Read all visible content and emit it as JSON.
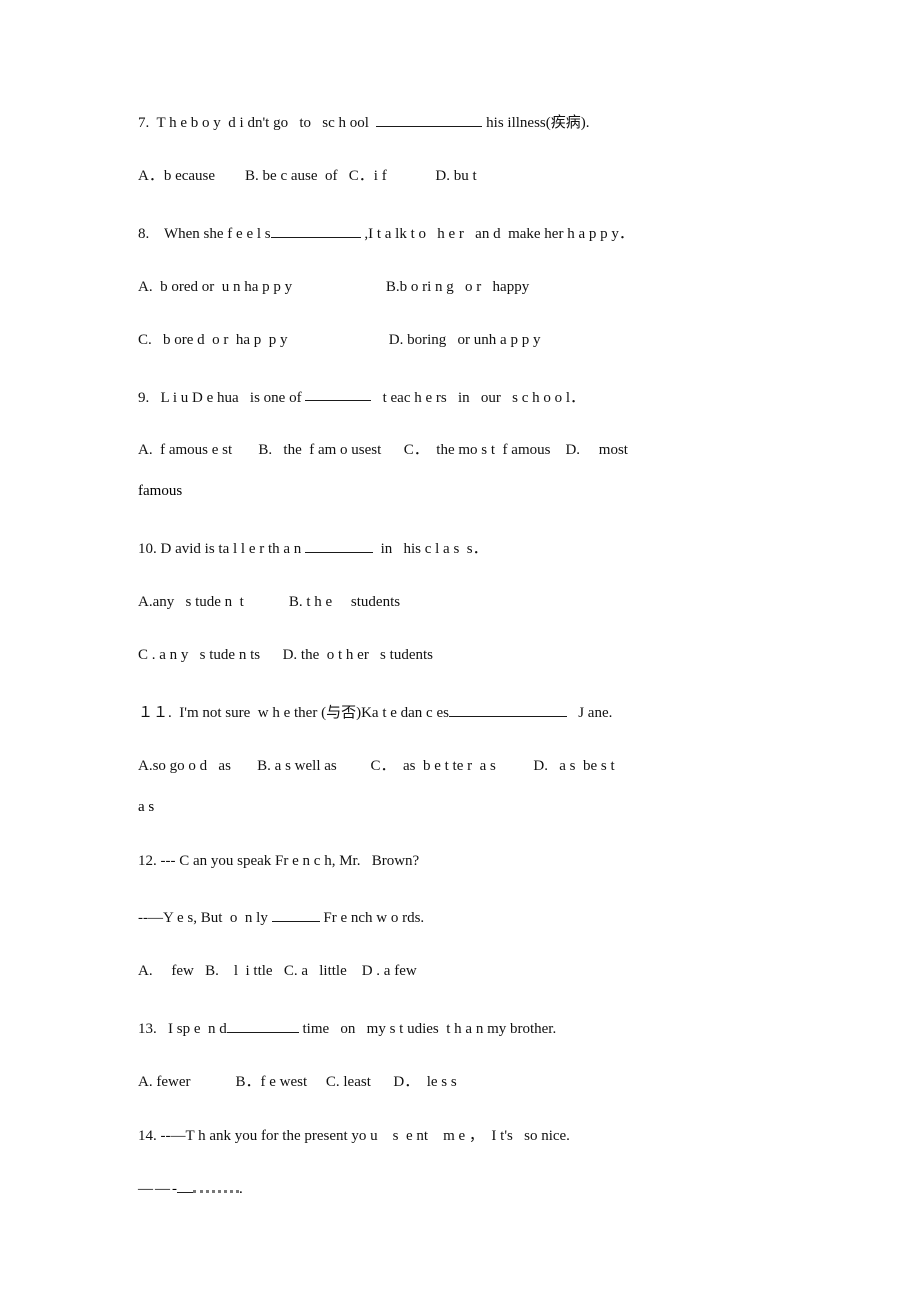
{
  "document": {
    "type": "english-grammar-worksheet",
    "question_range": "7-14",
    "background_color": "#ffffff",
    "text_color": "#111111"
  },
  "questions": [
    {
      "number": "7.",
      "stem_before": "7.  T h e b o y  d i dn't go   to   sc h ool  ",
      "stem_after": " his illness(疾病).",
      "options_line": "A．b ecause        B. be c ause  of   C．i f             D. bu t",
      "wrap": null
    },
    {
      "number": "8.",
      "stem_before": "8.    When she f e e l s",
      "stem_after": " ,I t a lk t o   h e r   an d  make her h a p p y．",
      "options_line": "A.  b ored or  u n ha p p y                         B.b o ri n g   o r   happy",
      "options_line2": "C.   b ore d  o r  ha p  p y                           D. boring   or unh a p p y",
      "wrap": null
    },
    {
      "number": "9.",
      "stem_before": "9.   L i u D e hua   is one of ",
      "stem_after": "   t eac h e rs   in   our   s c h o o l．",
      "options_line": "A.  f amous e st       B.   the  f am o usest      C．  the mo s t  f amous    D.     most",
      "wrap": "famous"
    },
    {
      "number": "10.",
      "stem_before": "10. D avid is ta l l e r th a n ",
      "stem_after": "  in   his c l a s  s．",
      "options_line": "A.any   s tude n  t            B. t h e     students",
      "options_line2": "C . a n y   s tude n ts      D. the  o t h er   s tudents",
      "wrap": null
    },
    {
      "number": "11.",
      "stem_before": "１１.  I'm not sure  w h e ther (与否)Ka t e dan c es",
      "stem_after": "   J ane.",
      "options_line": "A.so go o d   as       B. a s well as         C．  as  b e t te r  a s          D.   a s  be s t",
      "wrap": "a s"
    },
    {
      "number": "12.",
      "stem_line1": "12. --- C an you speak Fr e n c h, Mr.   Brown?",
      "stem_before2": "--—Y e s, But  o  n ly ",
      "stem_after2": " Fr e nch w o rds.",
      "options_line": "A.     few   B.    l  i ttle   C. a   little    D . a few",
      "wrap": null
    },
    {
      "number": "13.",
      "stem_before": "13.   I sp e  n d",
      "stem_after": " time   on   my s t udies  t h a n my brother.",
      "options_line": "A. fewer            B．f e west     C. least      D．  le s s",
      "wrap": null
    },
    {
      "number": "14.",
      "stem_line1": "14. --—T h ank you for the present yo u    s  e nt    m e ，  I t's   so nice.",
      "answer_dashes": "——",
      "answer_hyphen": "-",
      "answer_period": "."
    }
  ]
}
